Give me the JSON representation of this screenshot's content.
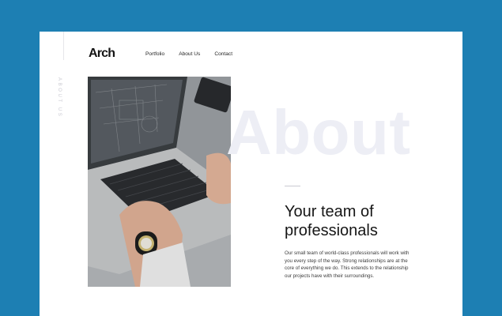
{
  "brand": {
    "logo": "Arch"
  },
  "nav": {
    "items": [
      "Portfolio",
      "About Us",
      "Contact"
    ]
  },
  "side": {
    "label": "ABOUT US"
  },
  "hero": {
    "watermark": "About"
  },
  "content": {
    "heading_line1": "Your team of",
    "heading_line2": "professionals",
    "paragraph": "Our small team of world-class professionals will work with you every step of the way. Strong relationships are at the core of everything we do. This extends to the relationship our projects have with their surroundings."
  },
  "colors": {
    "background": "#1d7fb3",
    "card": "#ffffff",
    "watermark": "#edeef5",
    "text": "#161616"
  }
}
